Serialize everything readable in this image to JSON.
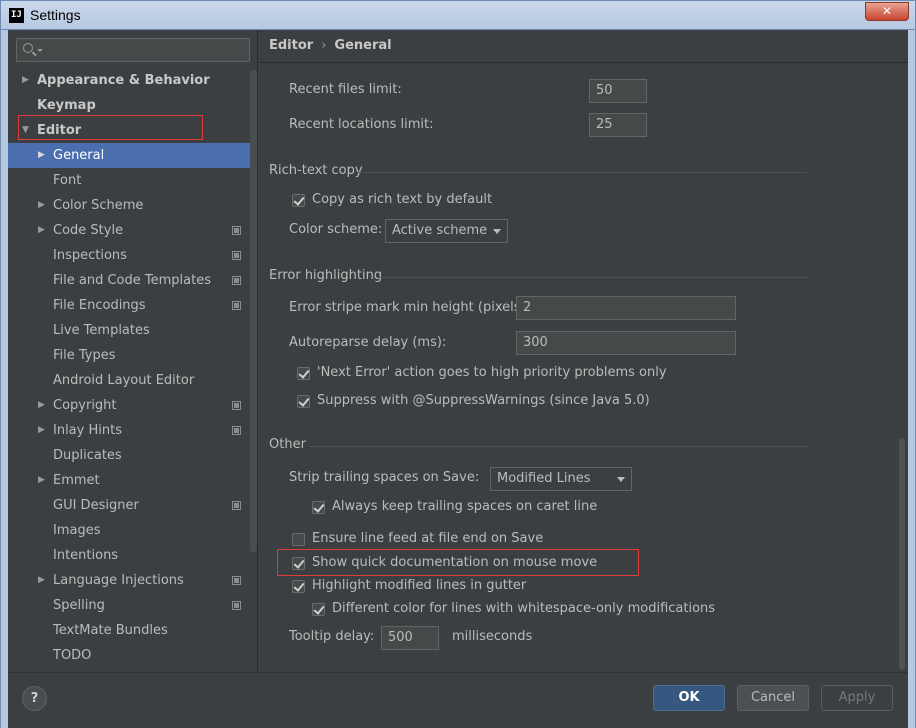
{
  "window": {
    "title": "Settings",
    "icon": "intellij-icon",
    "close_glyph": "✕"
  },
  "search": {
    "placeholder": ""
  },
  "tree": [
    {
      "label": "Appearance & Behavior",
      "arrow": "▶",
      "level": 0,
      "copy": false
    },
    {
      "label": "Keymap",
      "arrow": "",
      "level": 0,
      "copy": false
    },
    {
      "label": "Editor",
      "arrow": "▼",
      "level": 0,
      "copy": false
    },
    {
      "label": "General",
      "arrow": "▶",
      "level": 1,
      "copy": false,
      "selected": true
    },
    {
      "label": "Font",
      "arrow": "",
      "level": 1,
      "copy": false
    },
    {
      "label": "Color Scheme",
      "arrow": "▶",
      "level": 1,
      "copy": false
    },
    {
      "label": "Code Style",
      "arrow": "▶",
      "level": 1,
      "copy": true
    },
    {
      "label": "Inspections",
      "arrow": "",
      "level": 1,
      "copy": true
    },
    {
      "label": "File and Code Templates",
      "arrow": "",
      "level": 1,
      "copy": true
    },
    {
      "label": "File Encodings",
      "arrow": "",
      "level": 1,
      "copy": true
    },
    {
      "label": "Live Templates",
      "arrow": "",
      "level": 1,
      "copy": false
    },
    {
      "label": "File Types",
      "arrow": "",
      "level": 1,
      "copy": false
    },
    {
      "label": "Android Layout Editor",
      "arrow": "",
      "level": 1,
      "copy": false
    },
    {
      "label": "Copyright",
      "arrow": "▶",
      "level": 1,
      "copy": true
    },
    {
      "label": "Inlay Hints",
      "arrow": "▶",
      "level": 1,
      "copy": true
    },
    {
      "label": "Duplicates",
      "arrow": "",
      "level": 1,
      "copy": false
    },
    {
      "label": "Emmet",
      "arrow": "▶",
      "level": 1,
      "copy": false
    },
    {
      "label": "GUI Designer",
      "arrow": "",
      "level": 1,
      "copy": true
    },
    {
      "label": "Images",
      "arrow": "",
      "level": 1,
      "copy": false
    },
    {
      "label": "Intentions",
      "arrow": "",
      "level": 1,
      "copy": false
    },
    {
      "label": "Language Injections",
      "arrow": "▶",
      "level": 1,
      "copy": true
    },
    {
      "label": "Spelling",
      "arrow": "",
      "level": 1,
      "copy": true
    },
    {
      "label": "TextMate Bundles",
      "arrow": "",
      "level": 1,
      "copy": false
    },
    {
      "label": "TODO",
      "arrow": "",
      "level": 1,
      "copy": false
    }
  ],
  "breadcrumb": {
    "parent": "Editor",
    "sep": "›",
    "current": "General"
  },
  "recent": {
    "files_label": "Recent files limit:",
    "files_value": "50",
    "locations_label": "Recent locations limit:",
    "locations_value": "25"
  },
  "rich_text": {
    "title": "Rich-text copy",
    "copy_label": "Copy as rich text by default",
    "copy_checked": true,
    "scheme_label": "Color scheme:",
    "scheme_value": "Active scheme"
  },
  "error": {
    "title": "Error highlighting",
    "stripe_label": "Error stripe mark min height (pixels):",
    "stripe_value": "2",
    "delay_label": "Autoreparse delay (ms):",
    "delay_value": "300",
    "next_error_label": "'Next Error' action goes to high priority problems only",
    "next_error_checked": true,
    "suppress_label": "Suppress with @SuppressWarnings (since Java 5.0)",
    "suppress_checked": true
  },
  "other": {
    "title": "Other",
    "strip_label": "Strip trailing spaces on Save:",
    "strip_value": "Modified Lines",
    "keep_label": "Always keep trailing spaces on caret line",
    "keep_checked": true,
    "line_feed_label": "Ensure line feed at file end on Save",
    "line_feed_checked": false,
    "quick_doc_label": "Show quick documentation on mouse move",
    "quick_doc_checked": true,
    "highlight_label": "Highlight modified lines in gutter",
    "highlight_checked": true,
    "diff_color_label": "Different color for lines with whitespace-only modifications",
    "diff_color_checked": true,
    "tooltip_label": "Tooltip delay:",
    "tooltip_value": "500",
    "tooltip_unit": "milliseconds"
  },
  "footer": {
    "help": "?",
    "ok": "OK",
    "cancel": "Cancel",
    "apply": "Apply"
  }
}
